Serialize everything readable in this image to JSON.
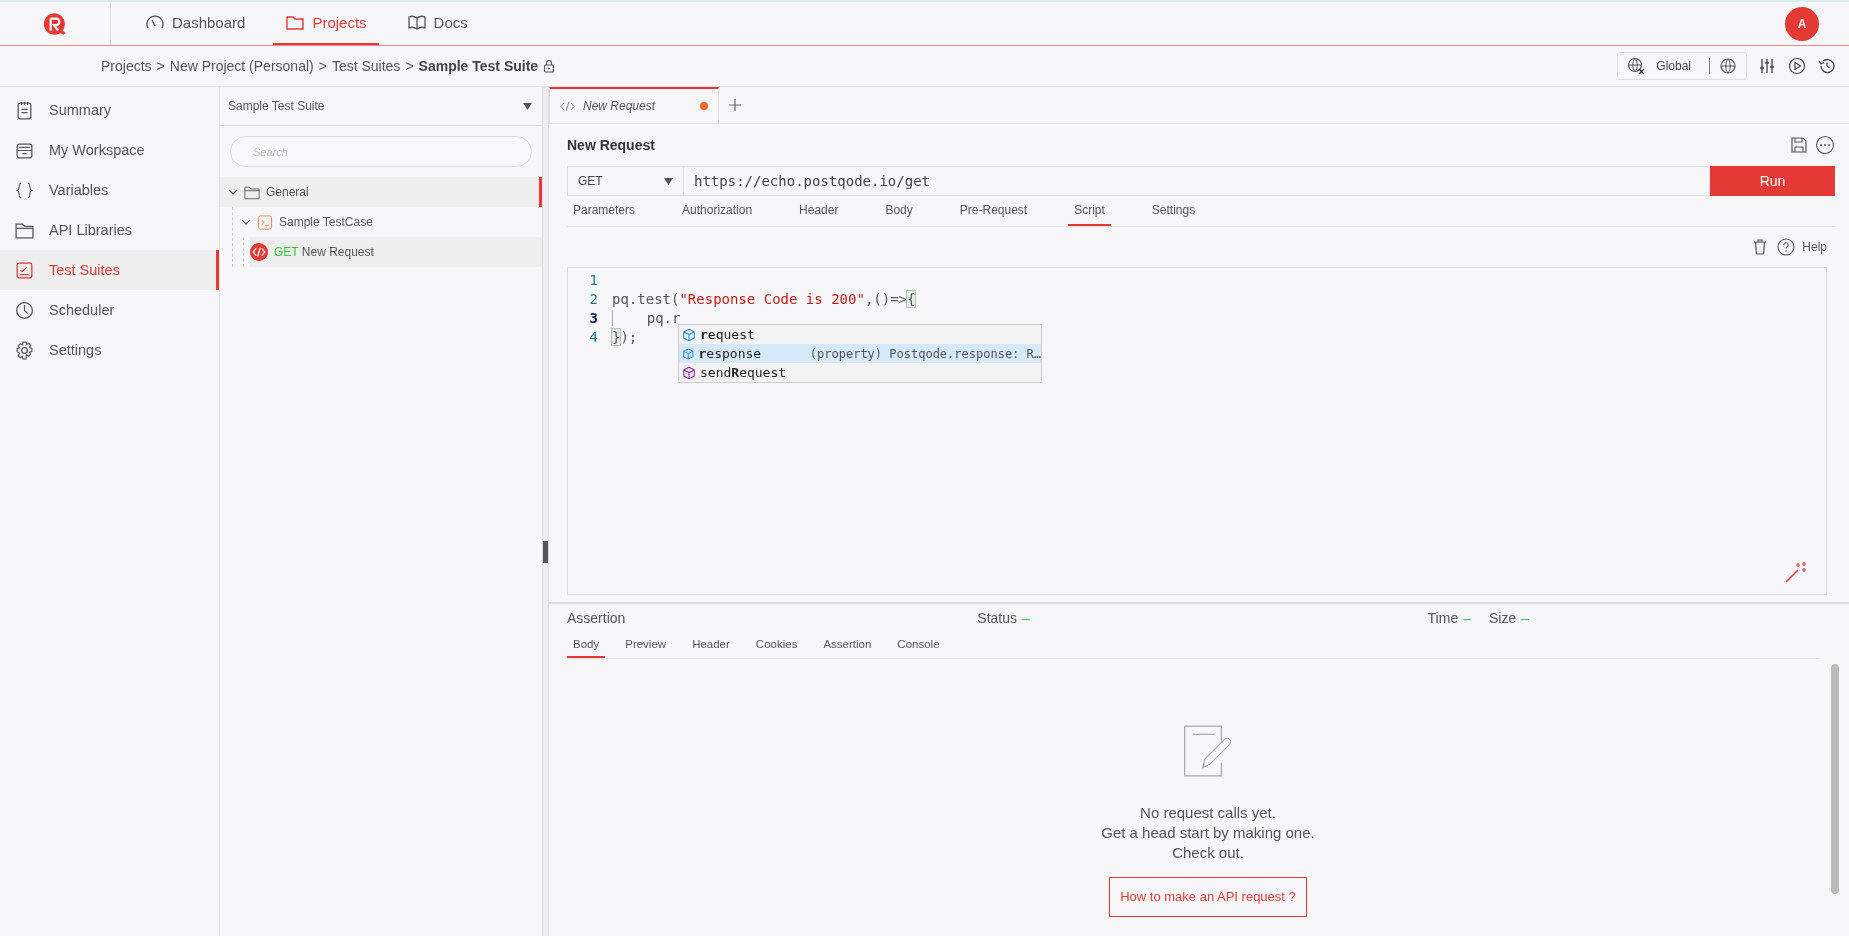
{
  "nav": {
    "items": [
      {
        "label": "Dashboard",
        "selected": false
      },
      {
        "label": "Projects",
        "selected": true
      },
      {
        "label": "Docs",
        "selected": false
      }
    ],
    "avatar": "A"
  },
  "breadcrumb": {
    "items": [
      "Projects",
      ">",
      "New Project (Personal)",
      ">",
      "Test Suites",
      ">"
    ],
    "current": "Sample Test Suite",
    "locked": true
  },
  "toolbar": {
    "environment": "Global"
  },
  "sidebar": {
    "items": [
      {
        "label": "Summary",
        "selected": false
      },
      {
        "label": "My Workspace",
        "selected": false
      },
      {
        "label": "Variables",
        "selected": false
      },
      {
        "label": "API Libraries",
        "selected": false
      },
      {
        "label": "Test Suites",
        "selected": true
      },
      {
        "label": "Scheduler",
        "selected": false
      },
      {
        "label": "Settings",
        "selected": false
      }
    ]
  },
  "tree_panel": {
    "suite": "Sample Test Suite",
    "search": {
      "placeholder": "Search"
    },
    "tree": [
      {
        "kind": "folder",
        "label": "General",
        "expanded": true,
        "selected": true,
        "children": [
          {
            "kind": "testcase",
            "label": "Sample TestCase",
            "expanded": true,
            "selected": false,
            "children": [
              {
                "kind": "request",
                "method": "GET",
                "label": "New Request",
                "selected": false
              }
            ]
          }
        ]
      }
    ]
  },
  "request_tabs": [
    {
      "label": "New Request",
      "unsaved": true,
      "selected": true
    }
  ],
  "request": {
    "title": "New Request",
    "method": "GET",
    "url": "https://echo.postqode.io/get",
    "run": "Run",
    "tabs": [
      {
        "label": "Parameters",
        "selected": false
      },
      {
        "label": "Authorization",
        "selected": false
      },
      {
        "label": "Header",
        "selected": false
      },
      {
        "label": "Body",
        "selected": false
      },
      {
        "label": "Pre-Request",
        "selected": false
      },
      {
        "label": "Script",
        "selected": true
      },
      {
        "label": "Settings",
        "selected": false
      }
    ],
    "help": "Help"
  },
  "editor": {
    "lines": [
      {
        "number": "1",
        "current": false
      },
      {
        "number": "2",
        "current": false,
        "tokens": [
          {
            "text": "pq.test(",
            "kind": "plain"
          },
          {
            "text": "\"Response Code is 200\"",
            "kind": "string"
          },
          {
            "text": ",()=>",
            "kind": "plain"
          },
          {
            "text": "{",
            "kind": "bracket"
          }
        ]
      },
      {
        "number": "3",
        "current": true,
        "tokens": [
          {
            "text": "    pq.r",
            "kind": "plain"
          }
        ]
      },
      {
        "number": "4",
        "current": false,
        "tokens": [
          {
            "text": "}",
            "kind": "bracket"
          },
          {
            "text": ");",
            "kind": "plain"
          }
        ]
      }
    ],
    "suggestions": [
      {
        "label": "**r**equest",
        "kind": "property",
        "selected": false
      },
      {
        "label": "**r**esponse",
        "kind": "property",
        "detail": "(property) Postqode.response: R…",
        "selected": true
      },
      {
        "label": "send**R**equest",
        "kind": "method",
        "selected": false
      }
    ]
  },
  "response": {
    "title": "Assertion",
    "status_label": "Status",
    "status": "–",
    "time_label": "Time",
    "time": "–",
    "size_label": "Size",
    "size": "–",
    "tabs": [
      {
        "label": "Body",
        "selected": true
      },
      {
        "label": "Preview",
        "selected": false
      },
      {
        "label": "Header",
        "selected": false
      },
      {
        "label": "Cookies",
        "selected": false
      },
      {
        "label": "Assertion",
        "selected": false
      },
      {
        "label": "Console",
        "selected": false
      }
    ],
    "empty_lines": [
      "No request calls yet.",
      "Get a head start by making one.",
      "Check out."
    ],
    "link": "How to make an API request ?"
  }
}
